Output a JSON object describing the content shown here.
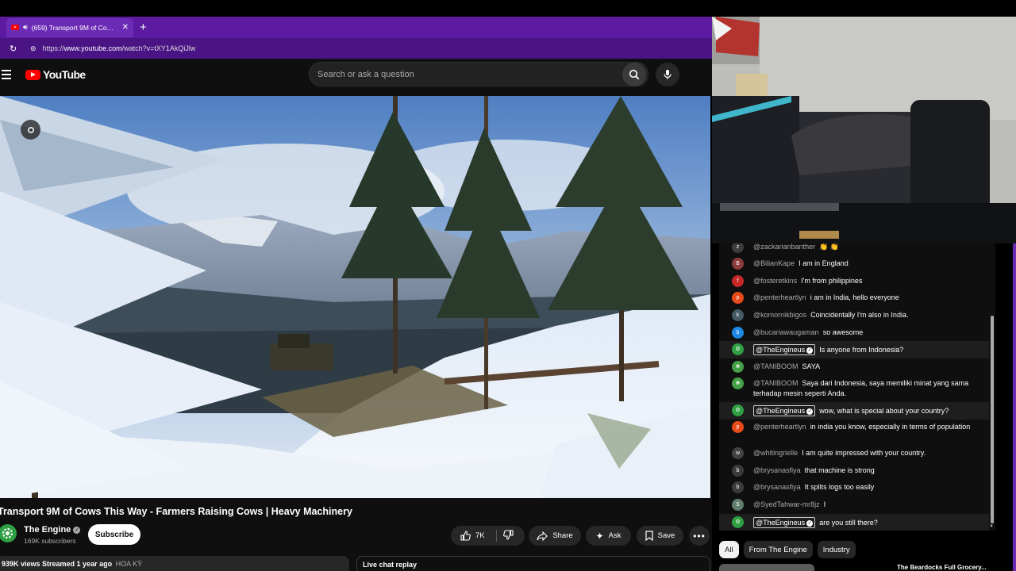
{
  "browser": {
    "tab_title": "(659) Transport 9M of Cows Th",
    "url_domain": "www.youtube.com",
    "url_prefix": "https://",
    "url_path": "/watch?v=tXY1AkQiJlw"
  },
  "header": {
    "logo_text": "YouTube",
    "search_placeholder": "Search or ask a question"
  },
  "video": {
    "title": "Transport 9M of Cows This Way - Farmers Raising Cows | Heavy Machinery",
    "channel_name": "The Engine",
    "subscribers": "169K subscribers",
    "subscribe_label": "Subscribe",
    "likes": "7K",
    "share_label": "Share",
    "ask_label": "Ask",
    "save_label": "Save",
    "views_date": "939K views  Streamed 1 year ago",
    "location_tag": "HOA KỲ",
    "live_chat_replay": "Live chat replay"
  },
  "chat": {
    "messages": [
      {
        "author": "@zackarianbanther",
        "text": "👏 👏",
        "initial": "z",
        "color": "#3d3d3d",
        "owner": false
      },
      {
        "author": "@BilianKape",
        "text": "I am in England",
        "initial": "B",
        "color": "#8d3b3b",
        "owner": false
      },
      {
        "author": "@fosteretkins",
        "text": "I'm from philippines",
        "initial": "f",
        "color": "#c62828",
        "owner": false
      },
      {
        "author": "@penterheartlyn",
        "text": "i am in India, hello everyone",
        "initial": "p",
        "color": "#e64a19",
        "owner": false
      },
      {
        "author": "@komornikbigos",
        "text": "Coincidentally I'm also in India.",
        "initial": "k",
        "color": "#455a64",
        "owner": false
      },
      {
        "author": "@bucariawaugaman",
        "text": "so awesome",
        "initial": "b",
        "color": "#1e88e5",
        "owner": false
      },
      {
        "author": "@TheEngineus",
        "text": "Is anyone from Indonesia?",
        "initial": "",
        "color": "#2ea043",
        "owner": true
      },
      {
        "author": "@TANIBOOM",
        "text": "SAYA",
        "initial": "",
        "color": "#43a047",
        "owner": false
      },
      {
        "author": "@TANIBOOM",
        "text": "Saya dari Indonesia, saya memiliki minat yang sama terhadap mesin seperti Anda.",
        "initial": "",
        "color": "#43a047",
        "owner": false
      },
      {
        "author": "@TheEngineus",
        "text": "wow, what is special about your country?",
        "initial": "",
        "color": "#2ea043",
        "owner": true
      },
      {
        "author": "@penterheartlyn",
        "text": "in india you know, especially in terms of population",
        "initial": "p",
        "color": "#e64a19",
        "owner": false
      },
      {
        "author": "@whitingrielle",
        "text": "I am quite impressed with your country.",
        "initial": "w",
        "color": "#424242",
        "owner": false
      },
      {
        "author": "@brysanasfiya",
        "text": "that machine is strong",
        "initial": "b",
        "color": "#3b3b3b",
        "owner": false
      },
      {
        "author": "@brysanasfiya",
        "text": "It splits logs too easily",
        "initial": "b",
        "color": "#3b3b3b",
        "owner": false
      },
      {
        "author": "@SyedTahwar-mr8jz",
        "text": "I",
        "initial": "S",
        "color": "#607d6b",
        "owner": false
      },
      {
        "author": "@TheEngineus",
        "text": "are you still there?",
        "initial": "",
        "color": "#2ea043",
        "owner": true
      }
    ]
  },
  "chips": [
    "All",
    "From The Engine",
    "Industry"
  ],
  "recommended_title": "The Beardocks Full Grocery..."
}
